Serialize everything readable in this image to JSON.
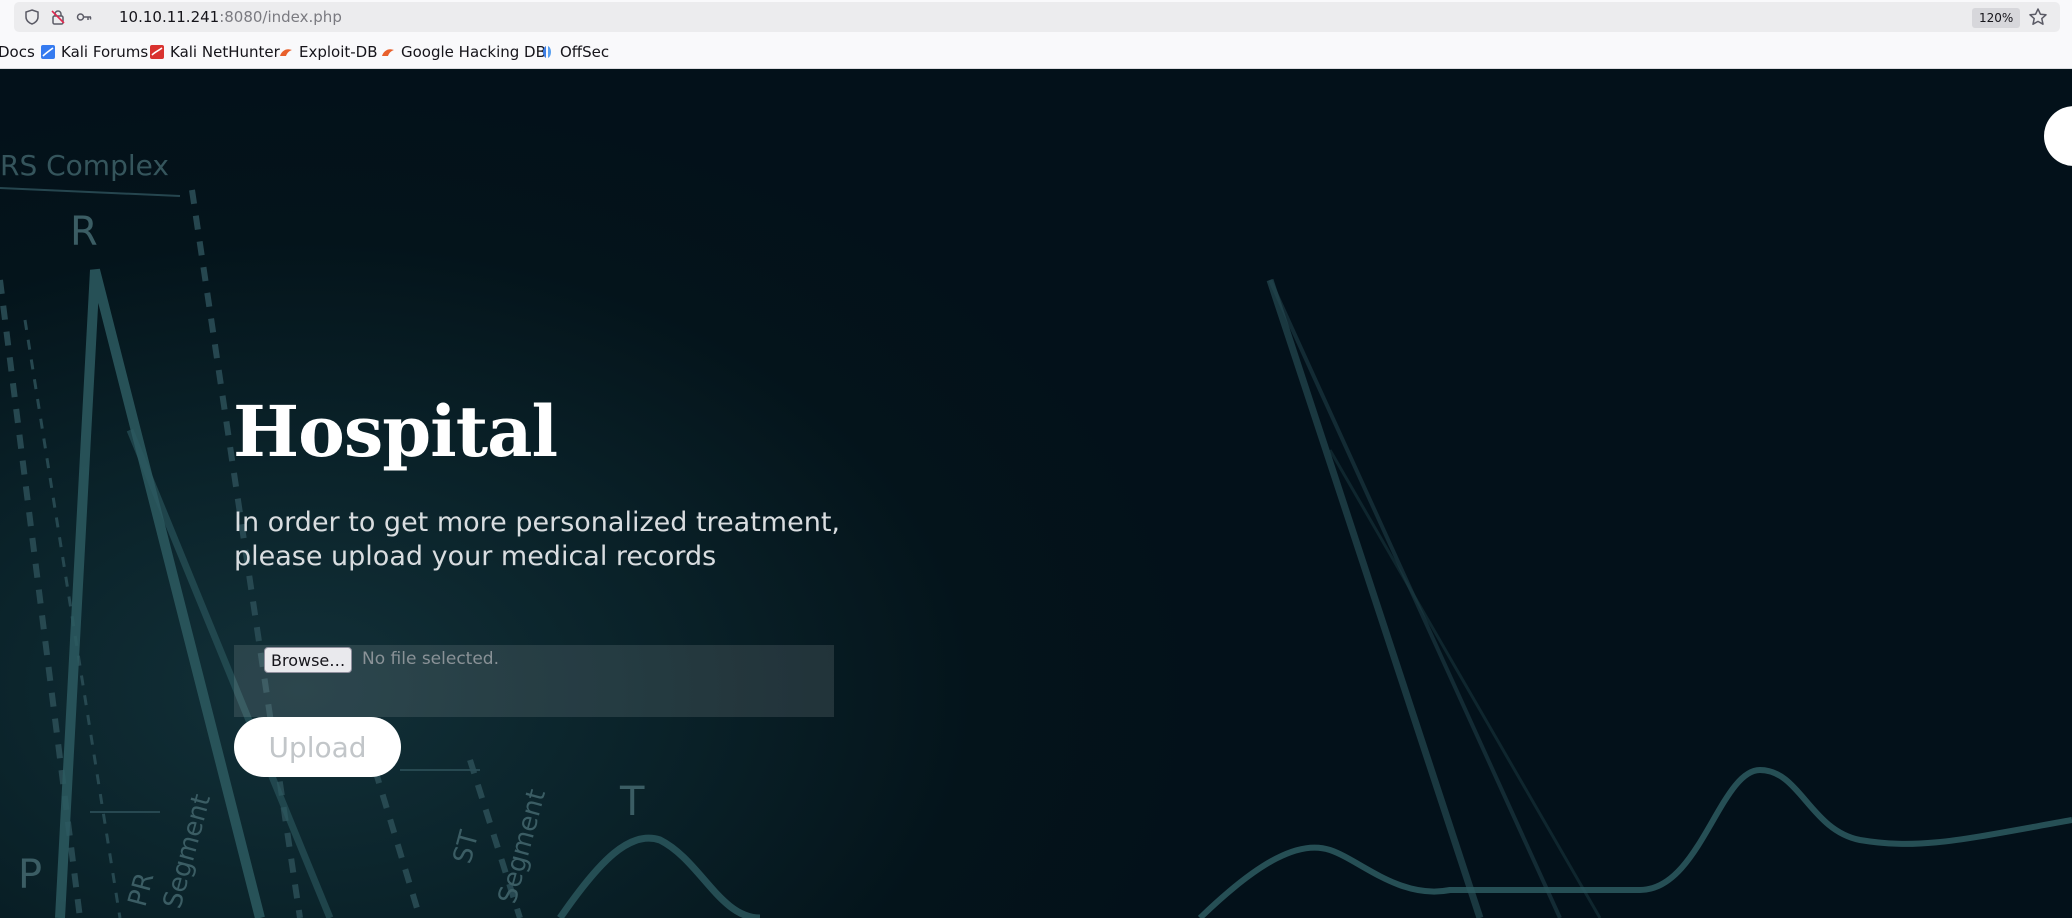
{
  "browser": {
    "url_host": "10.10.11.241",
    "url_rest": ":8080/index.php",
    "zoom": "120%",
    "icons": [
      "shield-icon",
      "insecure-lock-icon",
      "key-icon",
      "star-icon"
    ]
  },
  "bookmarks": [
    {
      "label": "Docs",
      "icon": "none"
    },
    {
      "label": "Kali Forums",
      "icon": "kali-forums-icon"
    },
    {
      "label": "Kali NetHunter",
      "icon": "kali-nethunter-icon"
    },
    {
      "label": "Exploit-DB",
      "icon": "exploit-db-icon"
    },
    {
      "label": "Google Hacking DB",
      "icon": "exploit-db-icon"
    },
    {
      "label": "OffSec",
      "icon": "offsec-icon"
    }
  ],
  "hero": {
    "title": "Hospital",
    "subtitle_line1": "In order to get more personalized treatment,",
    "subtitle_line2": "please upload your medical records"
  },
  "upload": {
    "browse_label": "Browse…",
    "file_status": "No file selected.",
    "submit_label": "Upload"
  },
  "background_labels": {
    "complex": "RS Complex",
    "r": "R",
    "t": "T",
    "p": "P",
    "pr": "PR",
    "segment1": "Segment",
    "st": "ST",
    "segment2": "Segment"
  },
  "colors": {
    "page_bg": "#04141b",
    "accent_white": "#ffffff",
    "ecg_line": "#2d5a60"
  }
}
